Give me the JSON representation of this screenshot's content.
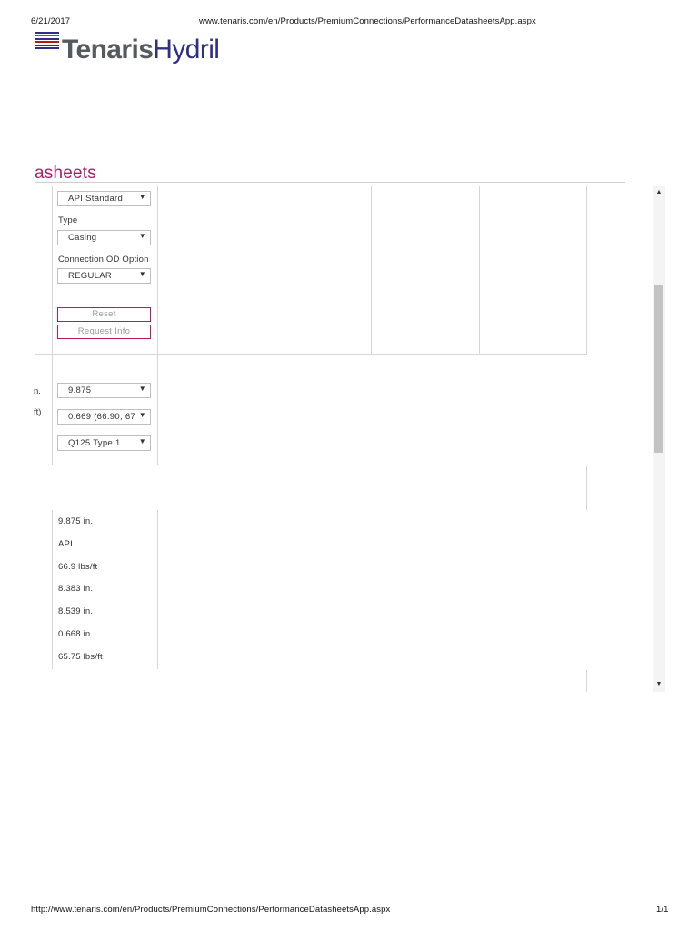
{
  "print_header": {
    "date": "6/21/2017",
    "url": "www.tenaris.com/en/Products/PremiumConnections/PerformanceDatasheetsApp.aspx"
  },
  "logo": {
    "part1": "Tenaris",
    "part2": "Hydril",
    "stripe_colors": [
      "#2d2f8a",
      "#1f8a3b",
      "#2d2f8a",
      "#b31b1b",
      "#2d2f8a"
    ]
  },
  "page_title": "asheets",
  "filters": {
    "standard": {
      "value": "API Standard"
    },
    "type": {
      "label": "Type",
      "value": "Casing"
    },
    "connection_od_option": {
      "label": "Connection OD Option",
      "value": "REGULAR"
    },
    "reset_label": "Reset",
    "request_info_label": "Request Info"
  },
  "params": {
    "cut_label_od": "n.",
    "cut_label_wall": "ft)",
    "od": "9.875",
    "wall": "0.669 (66.90, 67",
    "grade": "Q125 Type 1"
  },
  "values": [
    "9.875 in.",
    "API",
    "66.9 lbs/ft",
    "8.383 in.",
    "8.539 in.",
    "0.668 in.",
    "65.75 lbs/ft"
  ],
  "print_footer": {
    "url": "http://www.tenaris.com/en/Products/PremiumConnections/PerformanceDatasheetsApp.aspx",
    "page": "1/1"
  }
}
